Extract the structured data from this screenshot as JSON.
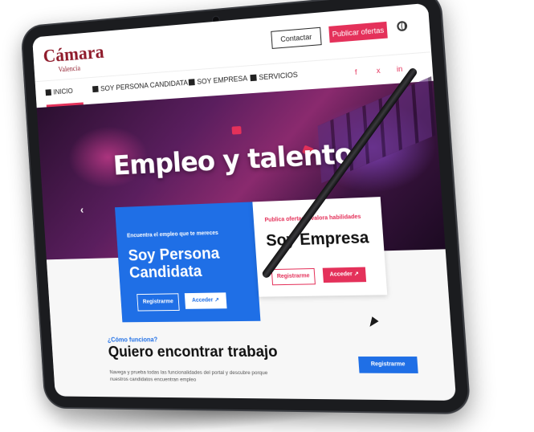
{
  "brand": {
    "name": "Cámara",
    "sub": "Valencia"
  },
  "header": {
    "contact_label": "Contactar",
    "publish_label": "Publicar ofertas"
  },
  "nav": {
    "items": [
      {
        "label": "INICIO"
      },
      {
        "label": "SOY PERSONA CANDIDATA"
      },
      {
        "label": "SOY EMPRESA"
      },
      {
        "label": "SERVICIOS"
      }
    ],
    "social": [
      "f",
      "x",
      "in"
    ]
  },
  "hero": {
    "title": "Empleo y talento",
    "arrow": "‹"
  },
  "card_candidate": {
    "kicker": "Encuentra el empleo que te mereces",
    "title_line1": "Soy Persona",
    "title_line2": "Candidata",
    "register_label": "Registrarme",
    "access_label": "Acceder ↗"
  },
  "card_company": {
    "kicker": "Publica ofertas y valora habilidades",
    "title": "Soy Empresa",
    "register_label": "Registrarme",
    "access_label": "Acceder ↗"
  },
  "how": {
    "kicker": "¿Cómo funciona?",
    "title": "Quiero encontrar trabajo",
    "desc": "Navega y prueba todas las funcionalidades del portal y descubre porque nuestros candidatos encuentran empleo",
    "register_label": "Registrarme"
  },
  "colors": {
    "brand": "#8f1b2b",
    "accent": "#e4315a",
    "blue": "#1f6fe6"
  }
}
